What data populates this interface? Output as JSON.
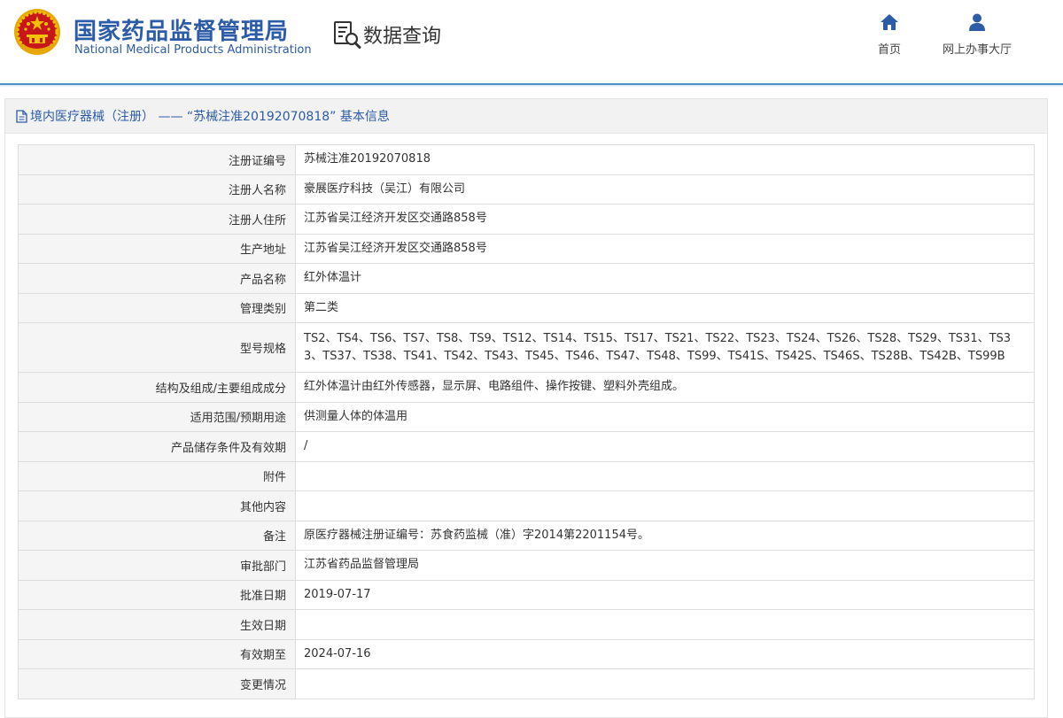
{
  "header": {
    "agency_cn": "国家药品监督管理局",
    "agency_en": "National Medical Products Administration",
    "query_title": "数据查询",
    "nav": [
      {
        "label": "首页",
        "icon": "home-icon"
      },
      {
        "label": "网上办事大厅",
        "icon": "user-icon"
      }
    ]
  },
  "panel": {
    "title": "境内医疗器械（注册） —— “苏械注准20192070818” 基本信息",
    "rows": [
      {
        "label": "注册证编号",
        "value": "苏械注准20192070818"
      },
      {
        "label": "注册人名称",
        "value": "豪展医疗科技（吴江）有限公司"
      },
      {
        "label": "注册人住所",
        "value": "江苏省吴江经济开发区交通路858号"
      },
      {
        "label": "生产地址",
        "value": "江苏省吴江经济开发区交通路858号"
      },
      {
        "label": "产品名称",
        "value": "红外体温计"
      },
      {
        "label": "管理类别",
        "value": "第二类"
      },
      {
        "label": "型号规格",
        "value": "TS2、TS4、TS6、TS7、TS8、TS9、TS12、TS14、TS15、TS17、TS21、TS22、TS23、TS24、TS26、TS28、TS29、TS31、TS33、TS37、TS38、TS41、TS42、TS43、TS45、TS46、TS47、TS48、TS99、TS41S、TS42S、TS46S、TS28B、TS42B、TS99B"
      },
      {
        "label": "结构及组成/主要组成成分",
        "value": "红外体温计由红外传感器，显示屏、电路组件、操作按键、塑料外壳组成。"
      },
      {
        "label": "适用范围/预期用途",
        "value": "供测量人体的体温用"
      },
      {
        "label": "产品储存条件及有效期",
        "value": "/"
      },
      {
        "label": "附件",
        "value": ""
      },
      {
        "label": "其他内容",
        "value": ""
      },
      {
        "label": "备注",
        "value": "原医疗器械注册证编号：苏食药监械（准）字2014第2201154号。"
      },
      {
        "label": "审批部门",
        "value": "江苏省药品监督管理局"
      },
      {
        "label": "批准日期",
        "value": "2019-07-17"
      },
      {
        "label": "生效日期",
        "value": ""
      },
      {
        "label": "有效期至",
        "value": "2024-07-16"
      },
      {
        "label": "变更情况",
        "value": ""
      }
    ]
  },
  "colors": {
    "brand_blue": "#2c5ba8",
    "header_line": "#4f8ec7",
    "emblem_red": "#c8161d",
    "emblem_gold": "#f2c200"
  }
}
